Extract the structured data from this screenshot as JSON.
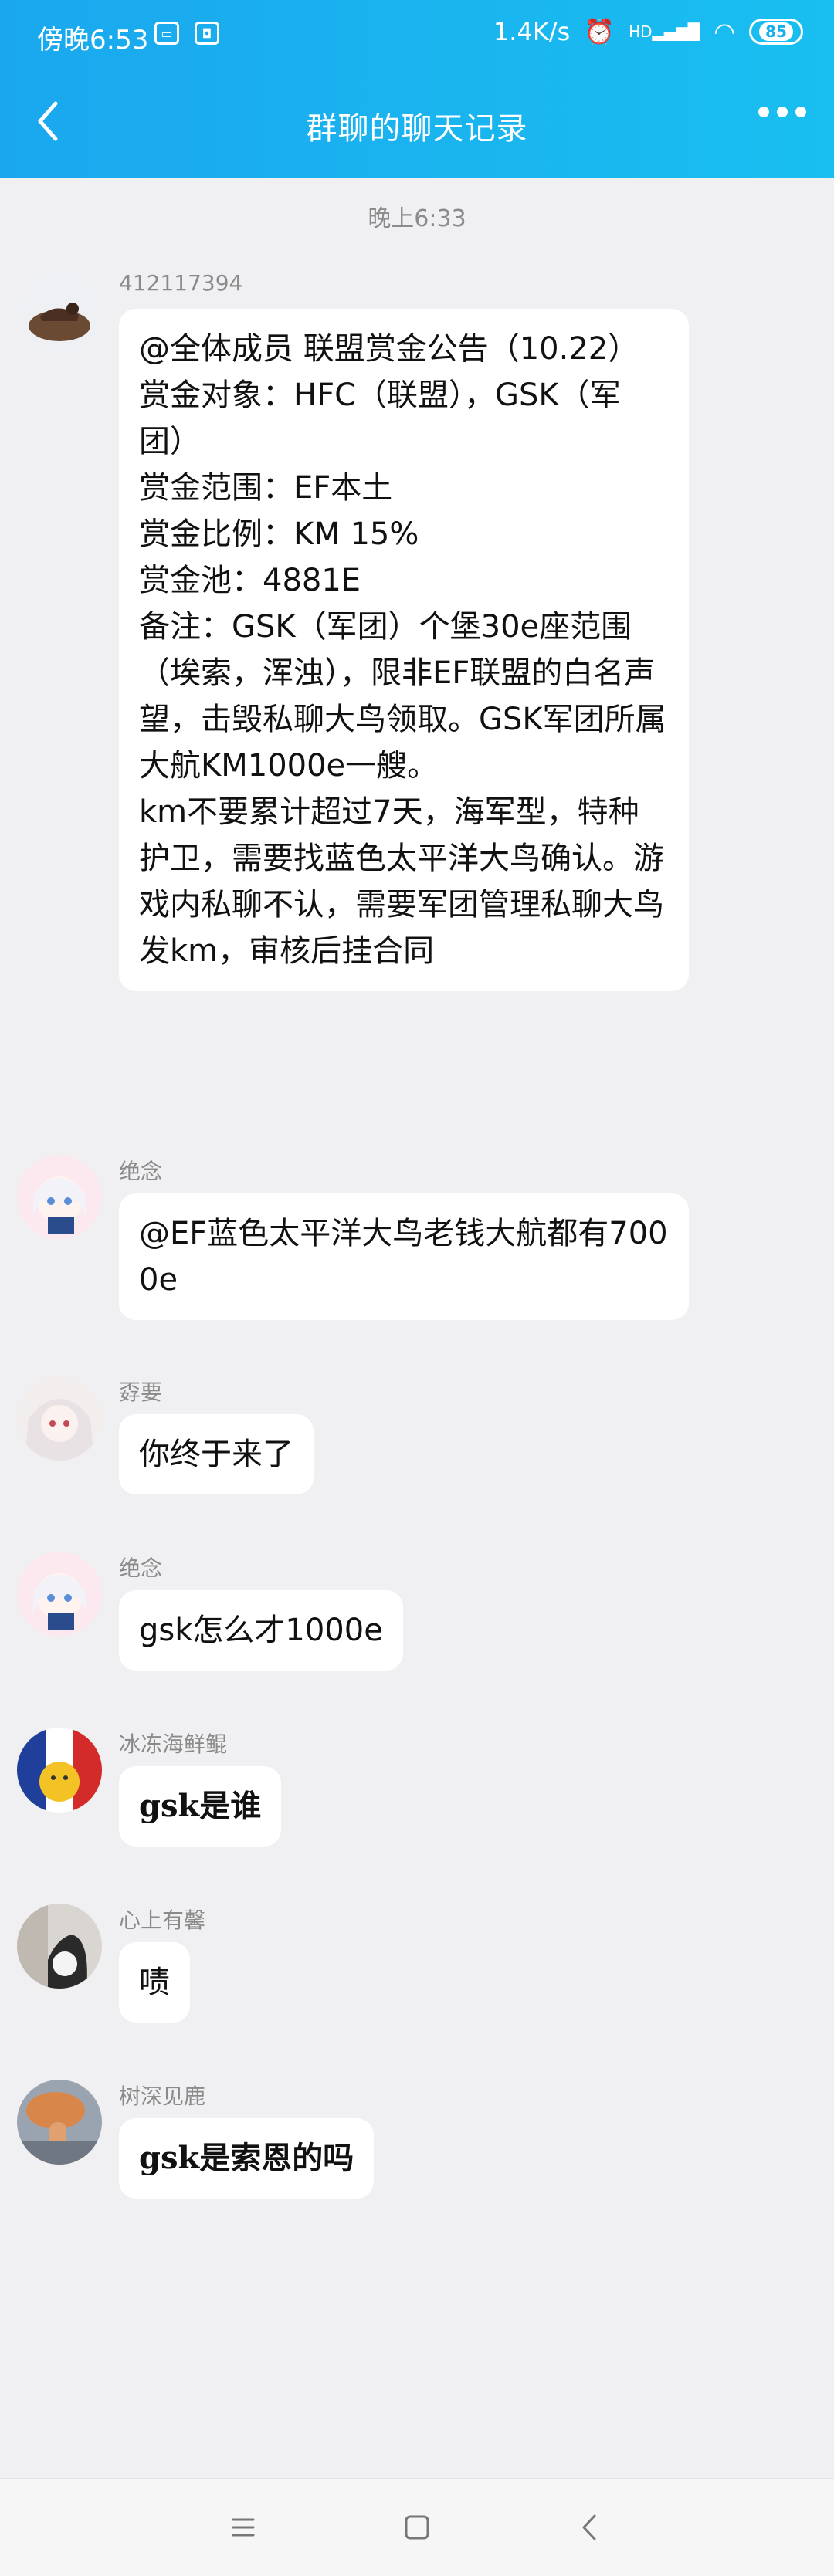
{
  "status_bar": {
    "time": "傍晚6:53",
    "net_speed": "1.4K/s",
    "hd": "HD",
    "battery": "85"
  },
  "header": {
    "title": "群聊的聊天记录"
  },
  "timestamp": "晚上6:33",
  "messages": [
    {
      "sender": "412117394",
      "text": "@全体成员 联盟赏金公告（10.22）\n赏金对象：HFC（联盟），GSK（军团）\n赏金范围：EF本土\n赏金比例：KM 15%\n赏金池：4881E\n备注：GSK（军团）个堡30e座范围（埃索，浑浊），限非EF联盟的白名声望，击毁私聊大鸟领取。GSK军团所属大航KM1000e一艘。\nkm不要累计超过7天，海军型，特种护卫，需要找蓝色太平洋大鸟确认。游戏内私聊不认，需要军团管理私聊大鸟发km，审核后挂合同"
    },
    {
      "sender": "绝念",
      "text": "@EF蓝色太平洋大鸟老钱大航都有7000e"
    },
    {
      "sender": "孬要",
      "text": "你终于来了"
    },
    {
      "sender": "绝念",
      "text": "gsk怎么才1000e"
    },
    {
      "sender": "冰冻海鲜鲲",
      "text": "gsk是谁"
    },
    {
      "sender": "心上有馨",
      "text": "啧"
    },
    {
      "sender": "树深见鹿",
      "text": "gsk是索恩的吗"
    }
  ],
  "colors": {
    "header_gradient_start": "#1aa7ee",
    "header_gradient_end": "#19bff0",
    "background": "#f0f0f2",
    "bubble": "#ffffff"
  }
}
